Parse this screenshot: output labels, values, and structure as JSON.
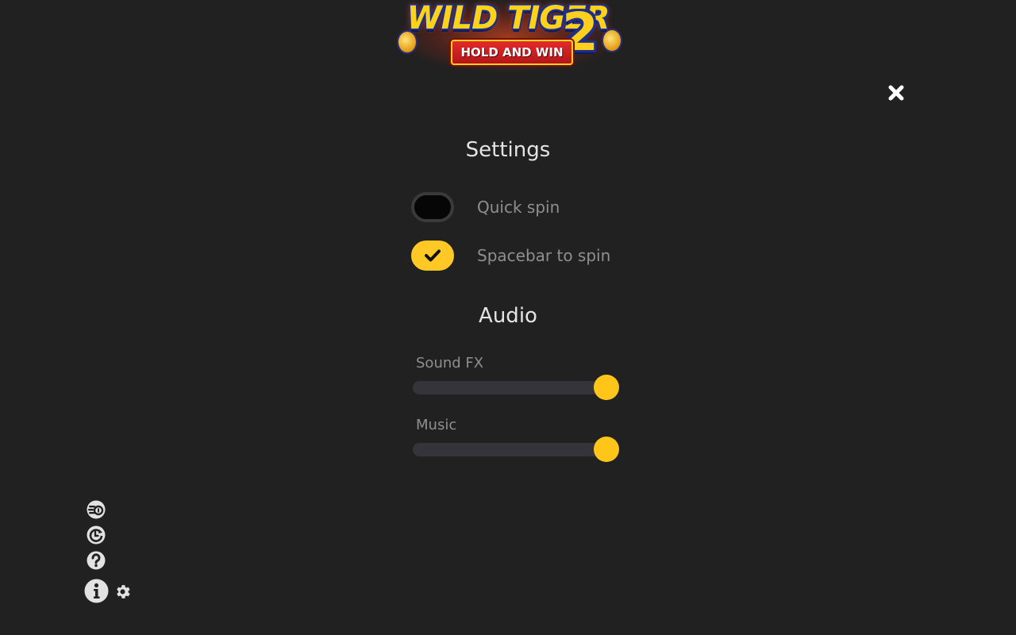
{
  "logo": {
    "title_line1": "WILD TIGER",
    "title_number": "2",
    "subtitle": "HOLD AND WIN"
  },
  "close": {
    "icon": "close-icon"
  },
  "settings": {
    "title": "Settings",
    "toggles": [
      {
        "label": "Quick spin",
        "enabled": false
      },
      {
        "label": "Spacebar to spin",
        "enabled": true
      }
    ]
  },
  "audio": {
    "title": "Audio",
    "sliders": [
      {
        "label": "Sound FX",
        "value": 1.0
      },
      {
        "label": "Music",
        "value": 1.0
      }
    ]
  },
  "side_menu": {
    "icons": [
      "bet-coins-icon",
      "autoplay-icon",
      "help-icon",
      "info-icon",
      "gear-icon"
    ]
  },
  "colors": {
    "background": "#212121",
    "accent": "#ffc824",
    "label_text": "#8f8f8f",
    "title_text": "#e4e4e4",
    "track": "#34343a"
  }
}
